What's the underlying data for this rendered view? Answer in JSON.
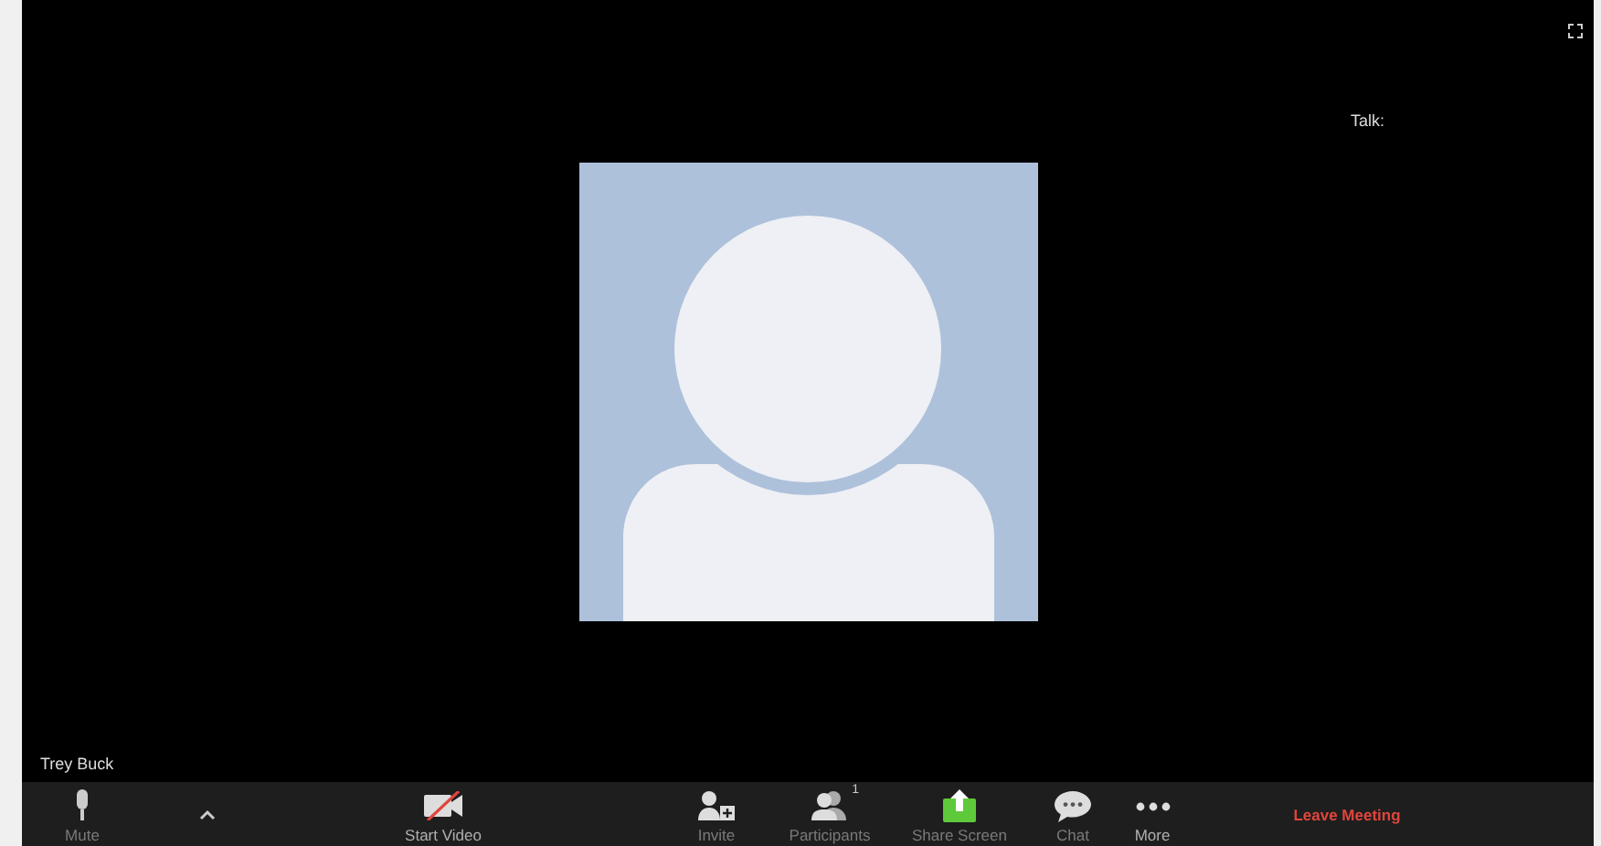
{
  "video": {
    "speaker_label": "Talk:",
    "participant_name": "Trey Buck"
  },
  "toolbar": {
    "buttons": [
      {
        "kind": "mic",
        "label": "Mute",
        "dim": true
      },
      {
        "kind": "caret"
      },
      {
        "kind": "video-off",
        "label": "Start Video",
        "dim": false
      },
      {
        "kind": "invite",
        "label": "Invite",
        "dim": true
      },
      {
        "kind": "participants",
        "label": "Participants",
        "dim": true,
        "count": "1"
      },
      {
        "kind": "share",
        "label": "Share Screen",
        "dim": true
      },
      {
        "kind": "chat",
        "label": "Chat",
        "dim": true
      },
      {
        "kind": "more",
        "label": "More",
        "dim": false
      },
      {
        "kind": "leave",
        "label": "Leave Meeting"
      }
    ]
  }
}
